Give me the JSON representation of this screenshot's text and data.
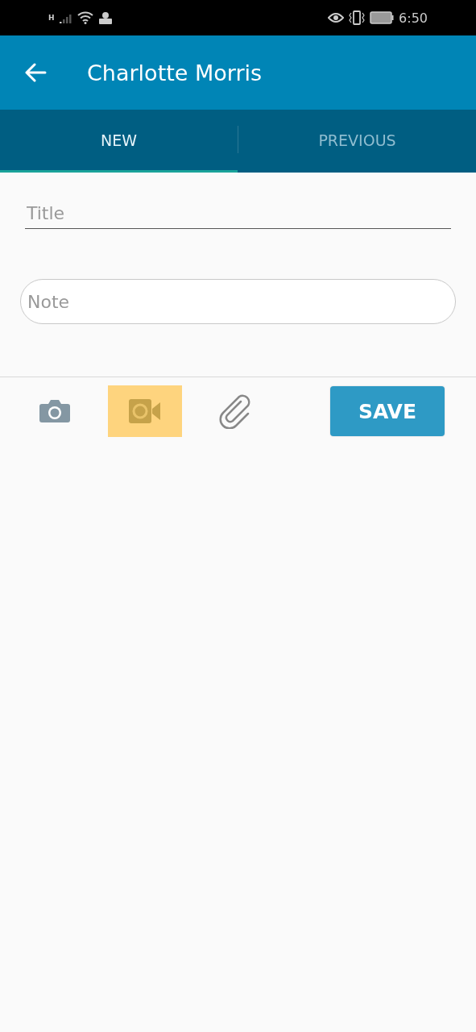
{
  "status_bar": {
    "network": "H",
    "time": "6:50"
  },
  "header": {
    "title": "Charlotte Morris"
  },
  "tabs": [
    {
      "label": "NEW",
      "selected": true
    },
    {
      "label": "PREVIOUS",
      "selected": false
    }
  ],
  "title_field": {
    "placeholder": "Title"
  },
  "note_field": {
    "placeholder": "Note"
  },
  "attachments": [
    {
      "kind": "camera",
      "selected": false
    },
    {
      "kind": "video",
      "selected": true
    },
    {
      "kind": "clip",
      "selected": false
    }
  ],
  "save_button": {
    "label": "SAVE"
  }
}
